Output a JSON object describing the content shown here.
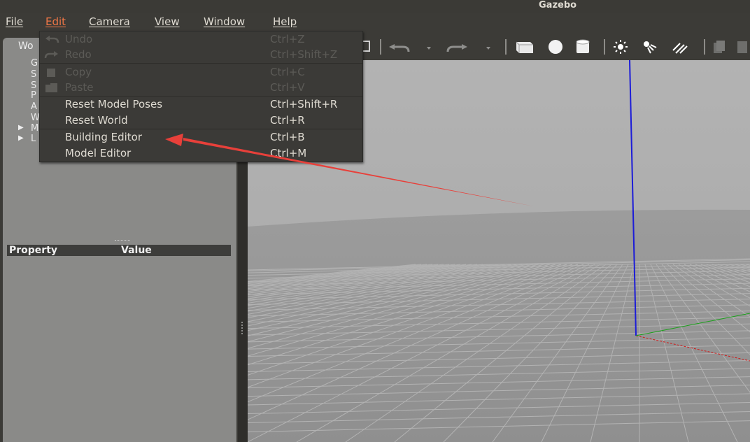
{
  "window": {
    "title": "Gazebo"
  },
  "menubar": {
    "items": [
      {
        "label": "File",
        "active": false
      },
      {
        "label": "Edit",
        "active": true
      },
      {
        "label": "Camera",
        "active": false
      },
      {
        "label": "View",
        "active": false
      },
      {
        "label": "Window",
        "active": false
      },
      {
        "label": "Help",
        "active": false
      }
    ]
  },
  "edit_menu": {
    "items": [
      {
        "label": "Undo",
        "shortcut": "Ctrl+Z",
        "enabled": false,
        "icon": "undo-icon"
      },
      {
        "label": "Redo",
        "shortcut": "Ctrl+Shift+Z",
        "enabled": false,
        "icon": "redo-icon"
      },
      {
        "label": "Copy",
        "shortcut": "Ctrl+C",
        "enabled": false,
        "icon": "copy-icon"
      },
      {
        "label": "Paste",
        "shortcut": "Ctrl+V",
        "enabled": false,
        "icon": "paste-icon"
      },
      {
        "label": "Reset Model Poses",
        "shortcut": "Ctrl+Shift+R",
        "enabled": true
      },
      {
        "label": "Reset World",
        "shortcut": "Ctrl+R",
        "enabled": true
      },
      {
        "label": "Building Editor",
        "shortcut": "Ctrl+B",
        "enabled": true
      },
      {
        "label": "Model Editor",
        "shortcut": "Ctrl+M",
        "enabled": true
      }
    ]
  },
  "left_panel": {
    "tab_label": "Wo",
    "tree_items": [
      "G",
      "S",
      "S",
      "P",
      "A",
      "W",
      "M",
      "L"
    ],
    "property_table": {
      "col_property": "Property",
      "col_value": "Value"
    }
  },
  "toolbar": {
    "icons": [
      "translate-icon",
      "undo-icon",
      "undo-history-dropdown-icon",
      "redo-icon",
      "redo-history-dropdown-icon",
      "box-shape-icon",
      "sphere-shape-icon",
      "cylinder-shape-icon",
      "point-light-icon",
      "spot-light-icon",
      "directional-light-icon",
      "copy-icon",
      "paste-icon"
    ]
  },
  "annotation": {
    "color": "#e8403a",
    "points_to": "Building Editor"
  },
  "colors": {
    "menu_active": "#f07746",
    "background": "#3c3b37",
    "viewport_ground": "#9d9d9d",
    "axis_z": "#1c1cd8",
    "axis_x": "#d01818",
    "axis_y": "#1aa01a"
  }
}
